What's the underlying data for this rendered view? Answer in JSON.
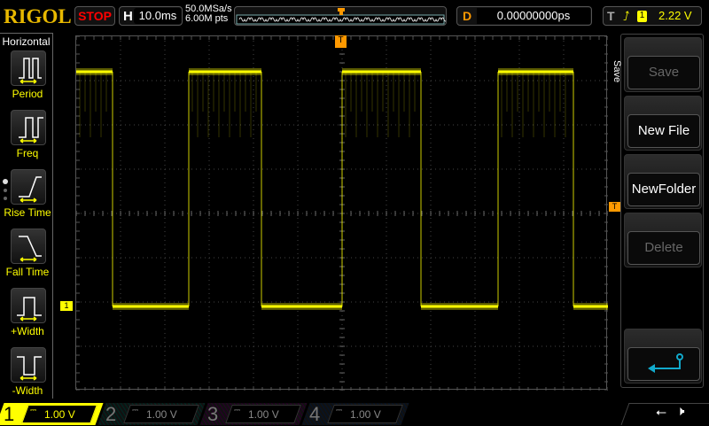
{
  "header": {
    "logo": "RIGOL",
    "run_state": "STOP",
    "h_label": "H",
    "timebase": "10.0ms",
    "sample_rate": "50.0MSa/s",
    "memory_depth": "6.00M pts",
    "d_label": "D",
    "delay": "0.00000000ps",
    "t_label": "T",
    "trigger_source": "1",
    "trigger_level": "2.22 V"
  },
  "left_menu": {
    "title": "Horizontal",
    "items": [
      {
        "label": "Period"
      },
      {
        "label": "Freq"
      },
      {
        "label": "Rise Time"
      },
      {
        "label": "Fall Time"
      },
      {
        "label": "+Width"
      },
      {
        "label": "-Width"
      }
    ]
  },
  "right_menu": {
    "title": "Save",
    "buttons": [
      {
        "label": "Save",
        "enabled": false
      },
      {
        "label": "New File",
        "enabled": true
      },
      {
        "label": "NewFolder",
        "enabled": true
      },
      {
        "label": "Delete",
        "enabled": false
      }
    ],
    "back_icon": "return-arrow-icon"
  },
  "channels": [
    {
      "num": "1",
      "scale": "1.00 V",
      "color": "#ffff00",
      "active": true
    },
    {
      "num": "2",
      "scale": "1.00 V",
      "color": "#00c0a0",
      "active": false
    },
    {
      "num": "3",
      "scale": "1.00 V",
      "color": "#c000c0",
      "active": false
    },
    {
      "num": "4",
      "scale": "1.00 V",
      "color": "#2060c0",
      "active": false
    }
  ],
  "markers": {
    "ch1": "1",
    "trigger": "T"
  },
  "chart_data": {
    "type": "line",
    "time_per_div_ms": 10,
    "volts_per_div": 1,
    "x_range_ms": [
      -60,
      60
    ],
    "high_v": 5.3,
    "low_v": 0,
    "start_level": "high",
    "edges_ms": [
      -51.8,
      -34.6,
      -18.2,
      0,
      17.8,
      35.2,
      52.2
    ]
  }
}
